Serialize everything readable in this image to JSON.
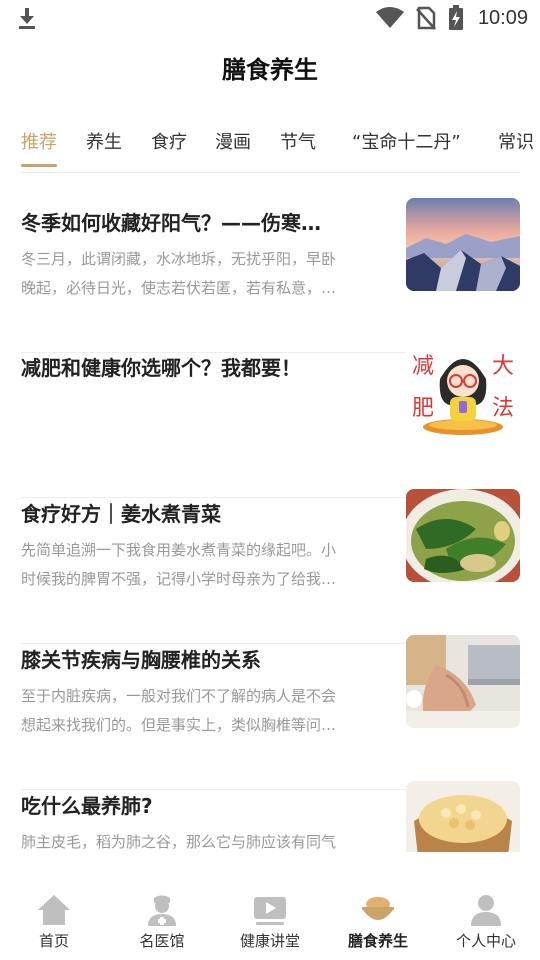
{
  "status_bar": {
    "time": "10:09",
    "icons": [
      "download-icon",
      "wifi-icon",
      "no-sim-icon",
      "battery-charging-icon"
    ]
  },
  "header": {
    "title": "膳食养生"
  },
  "tabs": [
    {
      "label": "推荐",
      "active": true
    },
    {
      "label": "养生",
      "active": false
    },
    {
      "label": "食疗",
      "active": false
    },
    {
      "label": "漫画",
      "active": false
    },
    {
      "label": "节气",
      "active": false
    },
    {
      "label": "“宝命十二丹”",
      "active": false
    },
    {
      "label": "常识",
      "active": false
    }
  ],
  "colors": {
    "accent": "#c9a46a",
    "inactive_icon": "#bfbfbf",
    "summary_text": "#999999"
  },
  "articles": [
    {
      "title": "冬季如何收藏好阳气？——伤寒…",
      "summary": "冬三月，此谓闭藏，水冰地坼，无扰乎阳，早卧晚起，必待日光，使志若伏若匿，若有私意，…",
      "thumbnail": "mountain-sunset-image"
    },
    {
      "title": "减肥和健康你选哪个？我都要！",
      "summary": "",
      "thumbnail": "cartoon-girl-diet-image"
    },
    {
      "title": "食疗好方｜姜水煮青菜",
      "summary": "先简单追溯一下我食用姜水煮青菜的缘起吧。小时候我的脾胃不强，记得小学时母亲为了给我…",
      "thumbnail": "ginger-greens-soup-image"
    },
    {
      "title": "膝关节疾病与胸腰椎的关系",
      "summary": "至于内脏疾病，一般对我们不了解的病人是不会想起来找我们的。但是事实上，类似胸椎等问…",
      "thumbnail": "laptop-blanket-image"
    },
    {
      "title": "吃什么最养肺?",
      "summary": "肺主皮毛，稻为肺之谷，那么它与肺应该有同气",
      "thumbnail": "rice-bowl-image"
    }
  ],
  "bottom_nav": [
    {
      "label": "首页",
      "icon": "home-icon",
      "active": false
    },
    {
      "label": "名医馆",
      "icon": "doctor-icon",
      "active": false
    },
    {
      "label": "健康讲堂",
      "icon": "video-play-icon",
      "active": false
    },
    {
      "label": "膳食养生",
      "icon": "food-bowl-icon",
      "active": true
    },
    {
      "label": "个人中心",
      "icon": "user-icon",
      "active": false
    }
  ]
}
